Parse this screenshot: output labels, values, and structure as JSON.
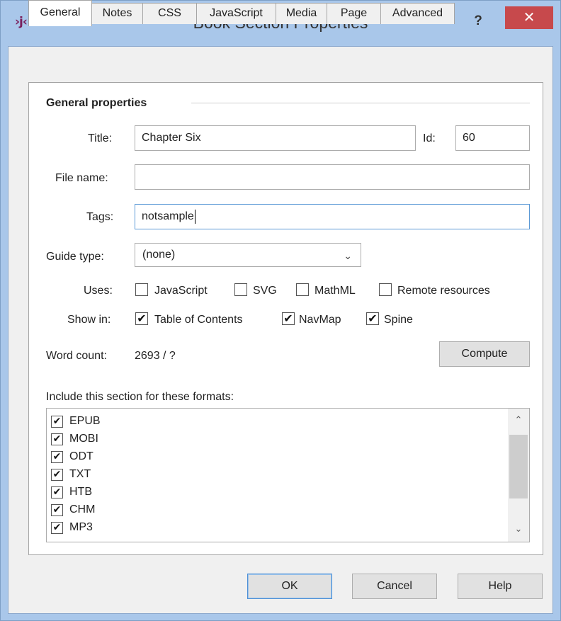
{
  "window": {
    "title": "Book Section Properties",
    "app_icon": "jutoh-logo-icon",
    "help_glyph": "?",
    "close_glyph": "✕"
  },
  "tabs": [
    {
      "label": "General",
      "active": true
    },
    {
      "label": "Notes"
    },
    {
      "label": "CSS"
    },
    {
      "label": "JavaScript"
    },
    {
      "label": "Media"
    },
    {
      "label": "Page"
    },
    {
      "label": "Advanced"
    }
  ],
  "general": {
    "group_title": "General properties",
    "title_label": "Title:",
    "title_value": "Chapter Six",
    "id_label": "Id:",
    "id_value": "60",
    "file_name_label": "File name:",
    "file_name_value": "",
    "tags_label": "Tags:",
    "tags_value": "notsample",
    "guide_type_label": "Guide type:",
    "guide_type_value": "(none)",
    "uses_label": "Uses:",
    "uses": [
      {
        "label": "JavaScript",
        "checked": false
      },
      {
        "label": "SVG",
        "checked": false
      },
      {
        "label": "MathML",
        "checked": false
      },
      {
        "label": "Remote resources",
        "checked": false
      }
    ],
    "show_in_label": "Show in:",
    "show_in": [
      {
        "label": "Table of Contents",
        "checked": true
      },
      {
        "label": "NavMap",
        "checked": true
      },
      {
        "label": "Spine",
        "checked": true
      }
    ],
    "word_count_label": "Word count:",
    "word_count_value": "2693 / ?",
    "compute_label": "Compute",
    "formats_label": "Include this section for these formats:",
    "formats": [
      {
        "label": "EPUB",
        "checked": true
      },
      {
        "label": "MOBI",
        "checked": true
      },
      {
        "label": "ODT",
        "checked": true
      },
      {
        "label": "TXT",
        "checked": true
      },
      {
        "label": "HTB",
        "checked": true
      },
      {
        "label": "CHM",
        "checked": true
      },
      {
        "label": "MP3",
        "checked": true
      }
    ]
  },
  "footer": {
    "ok_label": "OK",
    "cancel_label": "Cancel",
    "help_label": "Help"
  },
  "colors": {
    "frame": "#a9c7ea",
    "close_button": "#c7494c",
    "focus_border": "#5c9ad6"
  }
}
